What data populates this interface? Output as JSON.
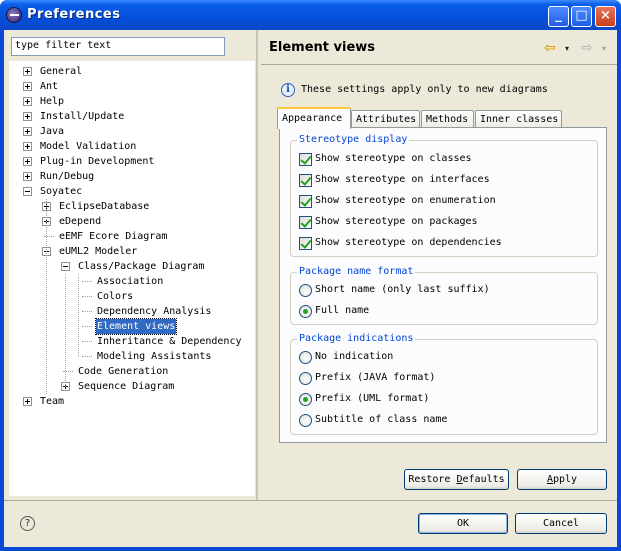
{
  "window": {
    "title": "Preferences"
  },
  "titlebar_buttons": {
    "minimize": "_",
    "maximize": "□",
    "close": "×"
  },
  "filter": {
    "value": "type filter text"
  },
  "tree": [
    {
      "label": "General",
      "toggle": "plus"
    },
    {
      "label": "Ant",
      "toggle": "plus"
    },
    {
      "label": "Help",
      "toggle": "plus"
    },
    {
      "label": "Install/Update",
      "toggle": "plus"
    },
    {
      "label": "Java",
      "toggle": "plus"
    },
    {
      "label": "Model Validation",
      "toggle": "plus"
    },
    {
      "label": "Plug-in Development",
      "toggle": "plus"
    },
    {
      "label": "Run/Debug",
      "toggle": "plus"
    },
    {
      "label": "Soyatec",
      "toggle": "minus"
    },
    {
      "label": "EclipseDatabase",
      "toggle": "plus"
    },
    {
      "label": "eDepend",
      "toggle": "plus"
    },
    {
      "label": "eEMF Ecore Diagram",
      "toggle": "none"
    },
    {
      "label": "eUML2 Modeler",
      "toggle": "minus"
    },
    {
      "label": "Class/Package Diagram",
      "toggle": "minus"
    },
    {
      "label": "Association",
      "toggle": "none"
    },
    {
      "label": "Colors",
      "toggle": "none"
    },
    {
      "label": "Dependency Analysis",
      "toggle": "none"
    },
    {
      "label": "Element views",
      "toggle": "none",
      "selected": true
    },
    {
      "label": "Inheritance & Dependency",
      "toggle": "none"
    },
    {
      "label": "Modeling Assistants",
      "toggle": "none"
    },
    {
      "label": "Code Generation",
      "toggle": "none"
    },
    {
      "label": "Sequence Diagram",
      "toggle": "plus"
    },
    {
      "label": "Team",
      "toggle": "plus"
    }
  ],
  "page": {
    "title": "Element views",
    "info": "These settings apply only to new diagrams",
    "nav": {
      "back": "⇦",
      "forward": "⇨",
      "dropdown": "▾"
    }
  },
  "tabs": [
    {
      "label": "Appearance",
      "active": true
    },
    {
      "label": "Attributes"
    },
    {
      "label": "Methods"
    },
    {
      "label": "Inner classes"
    }
  ],
  "stereotype_display": {
    "title": "Stereotype display",
    "items": [
      {
        "label": "Show stereotype on classes",
        "checked": true
      },
      {
        "label": "Show stereotype on interfaces",
        "checked": true
      },
      {
        "label": "Show stereotype on enumeration",
        "checked": true
      },
      {
        "label": "Show stereotype on packages",
        "checked": true
      },
      {
        "label": "Show stereotype on dependencies",
        "checked": true
      }
    ]
  },
  "package_name_format": {
    "title": "Package name format",
    "items": [
      {
        "label": "Short name (only last suffix)",
        "checked": false
      },
      {
        "label": "Full name",
        "checked": true
      }
    ]
  },
  "package_indications": {
    "title": "Package indications",
    "items": [
      {
        "label": "No indication",
        "checked": false
      },
      {
        "label": "Prefix (JAVA format)",
        "checked": false
      },
      {
        "label": "Prefix (UML format)",
        "checked": true
      },
      {
        "label": "Subtitle of class name",
        "checked": false
      }
    ]
  },
  "buttons": {
    "restore_pre": "Restore ",
    "restore_u": "D",
    "restore_post": "efaults",
    "apply_u": "A",
    "apply_post": "pply",
    "ok": "OK",
    "cancel": "Cancel",
    "help": "?"
  }
}
